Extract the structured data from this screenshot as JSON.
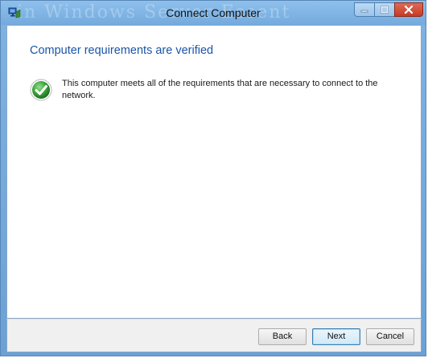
{
  "window": {
    "title": "Connect Computer",
    "background_ghost_text": "in Windows Server Essent"
  },
  "titlebar_controls": {
    "minimize_icon": "minimize-icon",
    "maximize_icon": "maximize-icon",
    "close_icon": "close-icon"
  },
  "main": {
    "heading": "Computer requirements are verified",
    "status_icon": "check-icon",
    "message": "This computer meets all of the requirements that are necessary to connect to the network."
  },
  "footer": {
    "back_label": "Back",
    "next_label": "Next",
    "cancel_label": "Cancel"
  },
  "colors": {
    "heading": "#1a55a8",
    "titlebar": "#7fb3e3",
    "success": "#3aa23a"
  }
}
